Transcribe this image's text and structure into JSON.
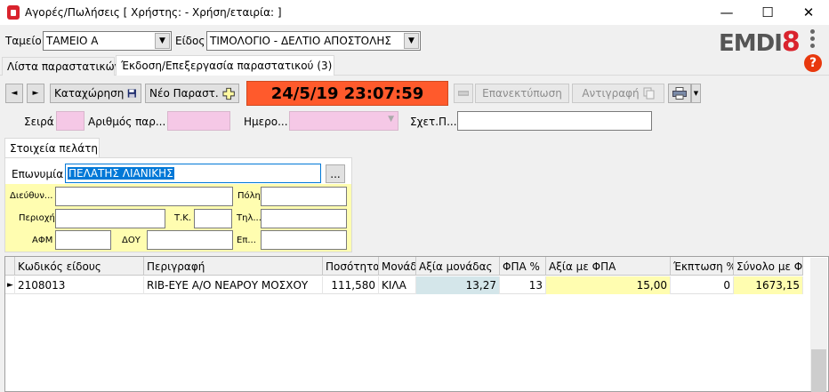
{
  "window": {
    "title": "Αγορές/Πωλήσεις  [ Χρήστης: - Χρήση/εταιρία: ]",
    "minimize": "—",
    "maximize": "☐",
    "close": "✕"
  },
  "header": {
    "tameio_label": "Ταμείο",
    "tameio_value": "ΤΑΜΕΙΟ Α",
    "eidos_label": "Είδος",
    "eidos_value": "ΤΙΜΟΛΟΓΙΟ - ΔΕΛΤΙΟ ΑΠΟΣΤΟΛΗΣ",
    "logo_text": "EMDI",
    "logo_num": "8",
    "help": "?"
  },
  "tabs": [
    {
      "label": "Λίστα παραστατικών"
    },
    {
      "label": "Έκδοση/Επεξεργασία παραστατικού (3)"
    }
  ],
  "toolbar": {
    "prev": "◄",
    "next": "►",
    "save_label": "Καταχώρηση",
    "new_label": "Νέο Παραστ.",
    "datetime": "24/5/19 23:07:59",
    "reprint_label": "Επανεκτύπωση",
    "copy_label": "Αντιγραφή"
  },
  "doc_fields": {
    "seira_label": "Σειρά",
    "arithmos_label": "Αριθμός παρ...",
    "imero_label": "Ημερο...",
    "sxet_label": "Σχετ.Π..."
  },
  "customer": {
    "tab_label": "Στοιχεία πελάτη",
    "eponymia_label": "Επωνυμία",
    "eponymia_value": "ΠΕΛΑΤΗΣ ΛΙΑΝΙΚΗΣ",
    "browse": "...",
    "dieuthynsi_label": "Διεύθυν...",
    "poli_label": "Πόλη",
    "perioxi_label": "Περιοχή",
    "tk_label": "Τ.Κ.",
    "til_label": "Τηλ...",
    "afm_label": "ΑΦΜ",
    "doy_label": "ΔΟΥ",
    "ep_label": "Επ..."
  },
  "grid": {
    "columns": [
      "Κωδικός είδους",
      "Περιγραφή",
      "Ποσότητα",
      "Μονάδα",
      "Αξία μονάδας",
      "ΦΠΑ %",
      "Αξία με ΦΠΑ",
      "Έκπτωση %",
      "Σύνολο με ΦΠΑ"
    ],
    "rows": [
      {
        "code": "2108013",
        "desc": "RIB-EYE A/O ΝΕΑΡΟΥ ΜΟΣΧΟΥ",
        "qty": "111,580",
        "unit": "ΚΙΛΑ",
        "unit_price": "13,27",
        "vat": "13",
        "price_vat": "15,00",
        "discount": "0",
        "total": "1673,15"
      }
    ]
  },
  "colors": {
    "datetime_bg": "#ff5a2c",
    "pink_field": "#f5c8e6",
    "yellow_panel": "#fffdb0",
    "selection": "#0078d7"
  }
}
